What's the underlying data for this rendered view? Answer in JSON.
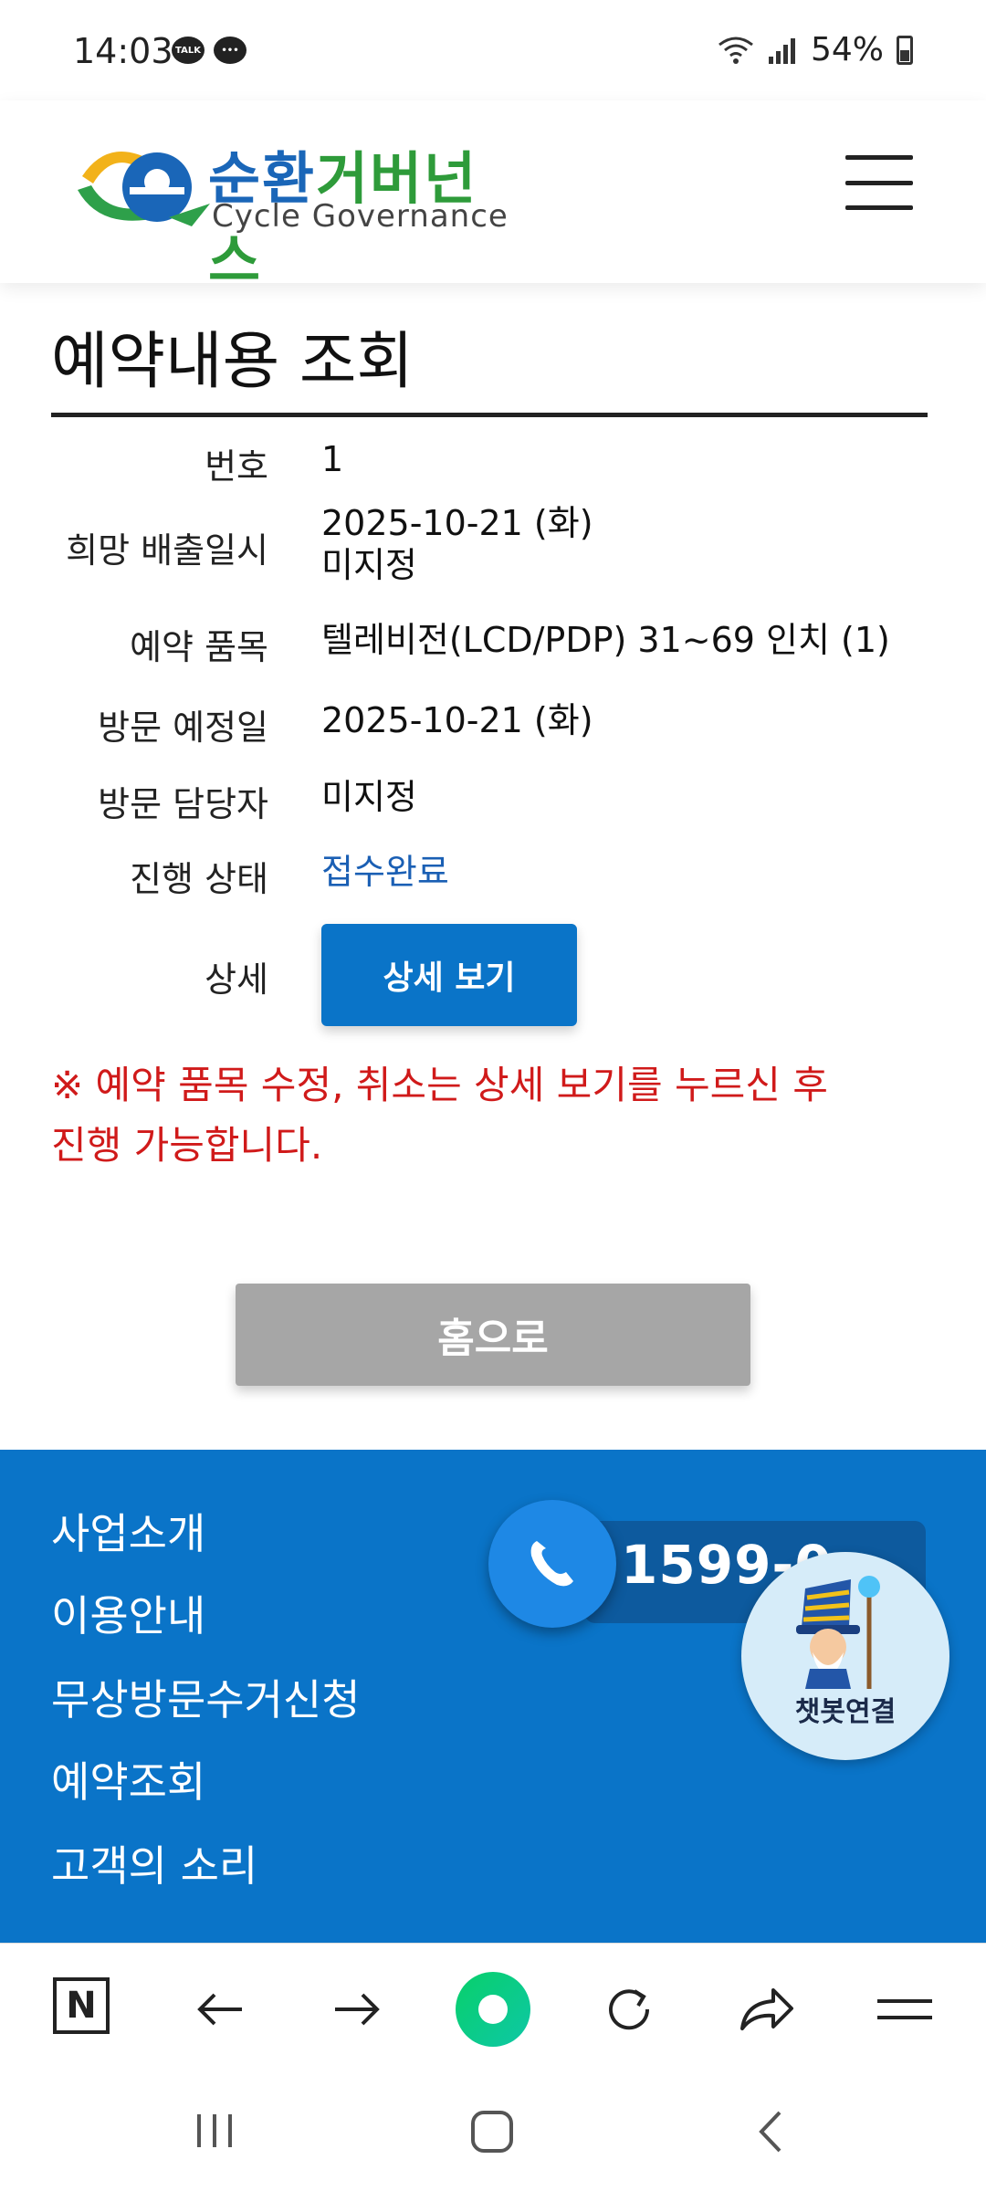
{
  "status_bar": {
    "time": "14:03",
    "talk_label": "TALK",
    "battery": "54%"
  },
  "header": {
    "logo_kr_part1": "순환",
    "logo_kr_part2": "거버넌스",
    "logo_en": "Cycle Governance",
    "menu_icon": "hamburger-menu-icon"
  },
  "page": {
    "title": "예약내용 조회",
    "rows": [
      {
        "label": "번호",
        "value": "1"
      },
      {
        "label": "희망 배출일시",
        "value": "2025-10-21 (화)",
        "value2": "미지정"
      },
      {
        "label": "예약 품목",
        "value": "텔레비전(LCD/PDP) 31~69 인치 (1)"
      },
      {
        "label": "방문 예정일",
        "value": "2025-10-21 (화)"
      },
      {
        "label": "방문 담당자",
        "value": "미지정"
      },
      {
        "label": "진행 상태",
        "value": "접수완료"
      },
      {
        "label": "상세",
        "value": ""
      }
    ],
    "detail_button": "상세 보기",
    "notice_line1": "※ 예약 품목 수정, 취소는 상세 보기를 누르신 후",
    "notice_line2": "진행 가능합니다.",
    "home_button": "홈으로",
    "status_color": "#1a5fb4",
    "notice_color": "#d01a1a"
  },
  "footer": {
    "links": [
      "사업소개",
      "이용안내",
      "무상방문수거신청",
      "예약조회",
      "고객의 소리"
    ],
    "phone": "1599-0",
    "chatbot_label": "챗봇연결",
    "bg_color": "#0a74c8"
  },
  "browser_bar": {
    "icons": [
      "naver-n-icon",
      "back-arrow-icon",
      "forward-arrow-icon",
      "green-dot-icon",
      "refresh-icon",
      "share-icon",
      "menu-icon"
    ]
  },
  "nav_bar": {
    "icons": [
      "recent-apps-icon",
      "home-icon",
      "back-icon"
    ]
  }
}
